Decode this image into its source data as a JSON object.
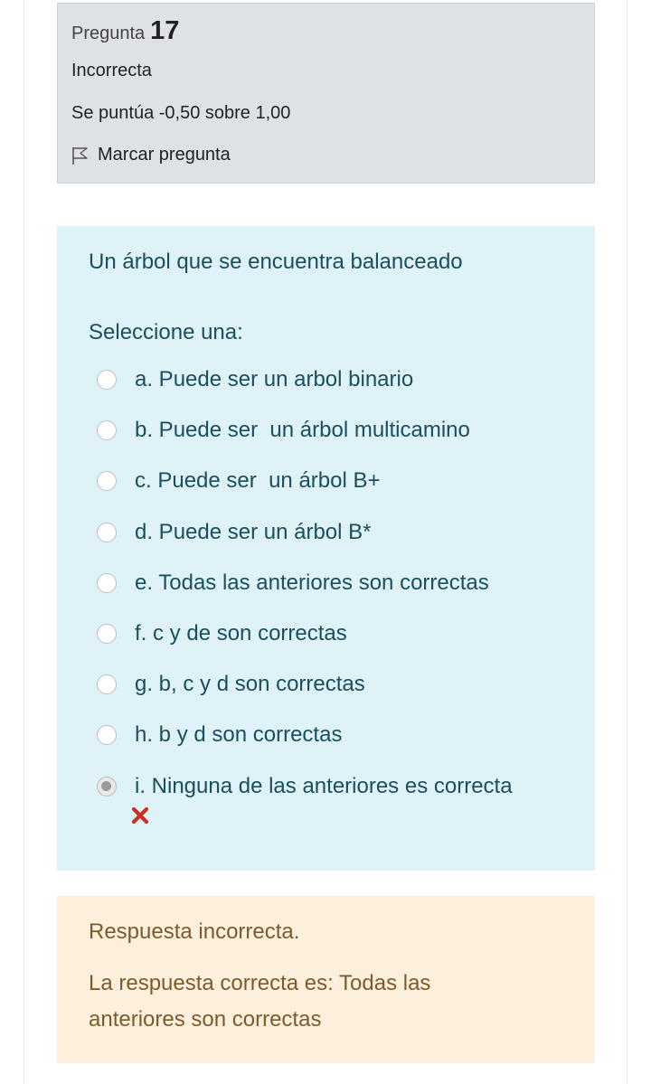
{
  "question_info": {
    "label": "Pregunta",
    "number": "17",
    "state": "Incorrecta",
    "grade": "Se puntúa -0,50 sobre 1,00",
    "flag_label": "Marcar pregunta"
  },
  "formulation": {
    "question_text": "Un árbol que se encuentra balanceado",
    "prompt": "Seleccione una:",
    "selected_answer": "i",
    "answers": [
      {
        "letter": "a",
        "text": "a. Puede ser un arbol binario"
      },
      {
        "letter": "b",
        "text": "b. Puede ser  un árbol multicamino"
      },
      {
        "letter": "c",
        "text": "c. Puede ser  un árbol B+"
      },
      {
        "letter": "d",
        "text": "d. Puede ser un árbol B*"
      },
      {
        "letter": "e",
        "text": "e. Todas las anteriores son correctas"
      },
      {
        "letter": "f",
        "text": "f. c y de son correctas"
      },
      {
        "letter": "g",
        "text": "g. b, c y d son correctas"
      },
      {
        "letter": "h",
        "text": "h. b y d son correctas"
      },
      {
        "letter": "i",
        "text": "i. Ninguna de las anteriores es correcta"
      }
    ]
  },
  "feedback": {
    "result": "Respuesta incorrecta.",
    "correct_answer": "La respuesta correcta es: Todas las anteriores son correctas"
  },
  "icons": {
    "flag": "flag-icon",
    "wrong": "incorrect-x-icon"
  },
  "colors": {
    "info_bg": "#dee2e6",
    "formulation_bg": "#def2f8",
    "formulation_text": "#1a4f5c",
    "feedback_bg": "#fcefdc",
    "feedback_text": "#7d5a29",
    "wrong_mark": "#ca3120"
  }
}
